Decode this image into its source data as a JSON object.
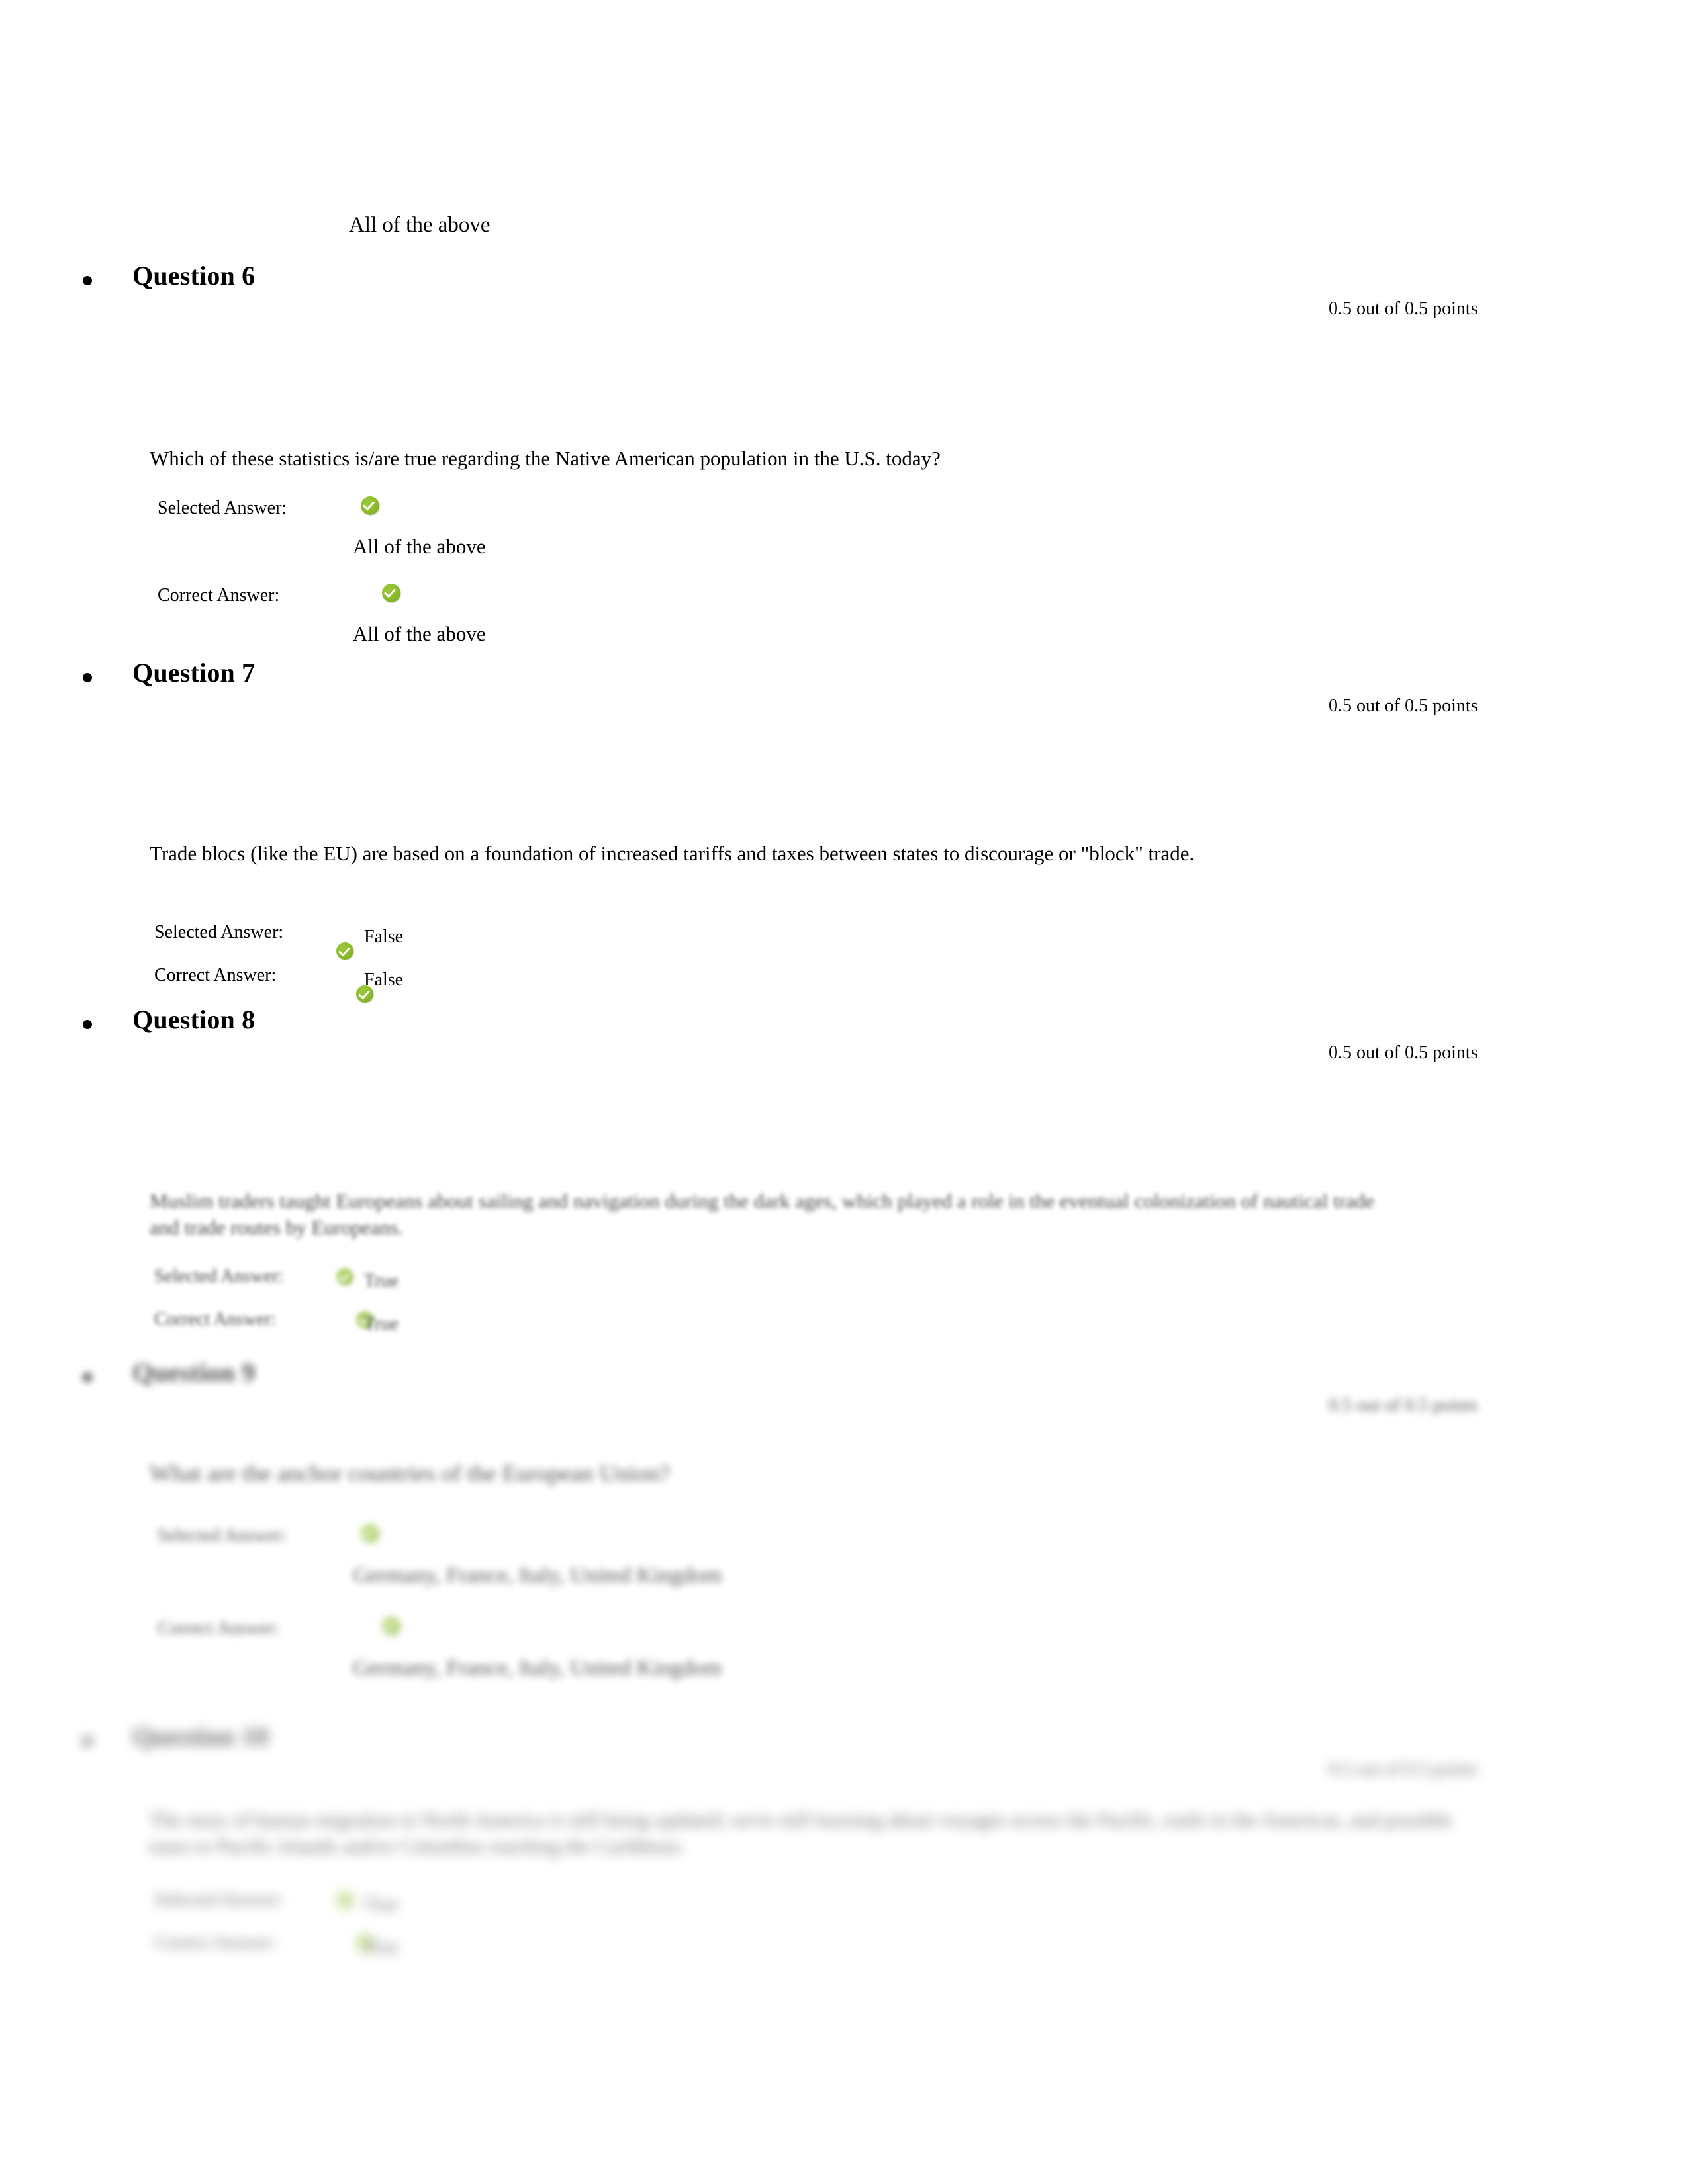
{
  "document": {
    "type": "quiz-review",
    "top_continued_answer": "All of the above",
    "accent_green": "#8bbb2c",
    "check_icon": "green-check-icon"
  },
  "labels": {
    "selected_answer": "Selected Answer:",
    "correct_answer": "Correct Answer:"
  },
  "questions": [
    {
      "heading": "Question 6",
      "points": "0.5 out of 0.5 points",
      "text": "Which of these statistics is/are true regarding the Native American population in the U.S. today?",
      "selected_answer": "All of the above",
      "correct_answer": "All of the above",
      "layout": "stacked",
      "blur": "none"
    },
    {
      "heading": "Question 7",
      "points": "0.5 out of 0.5 points",
      "text": "Trade blocs (like the EU) are based on a foundation of increased tariffs and taxes between states to discourage or \"block\" trade.",
      "selected_answer": "False",
      "correct_answer": "False",
      "layout": "inline",
      "blur": "none"
    },
    {
      "heading": "Question 8",
      "points": "0.5 out of 0.5 points",
      "text": "Muslim traders taught Europeans about sailing and navigation during the dark ages, which played a role in the eventual colonization of nautical trade and trade routes by Europeans.",
      "selected_answer": "True",
      "correct_answer": "True",
      "layout": "inline",
      "blur": "light"
    },
    {
      "heading": "Question 9",
      "points": "0.5 out of 0.5 points",
      "text": "What are the anchor countries of the European Union?",
      "selected_answer": "Germany, France, Italy, United Kingdom",
      "correct_answer": "Germany, France, Italy, United Kingdom",
      "layout": "stacked",
      "blur": "medium"
    },
    {
      "heading": "Question 10",
      "points": "0.5 out of 0.5 points",
      "text": "The story of human migration to North America is still being updated; we're still learning about voyages across the Pacific, trails in the Americas, and possible tours to Pacific Islands and/or Columbus reaching the Caribbean.",
      "selected_answer": "True",
      "correct_answer": "True",
      "layout": "inline",
      "blur": "heavy"
    }
  ]
}
